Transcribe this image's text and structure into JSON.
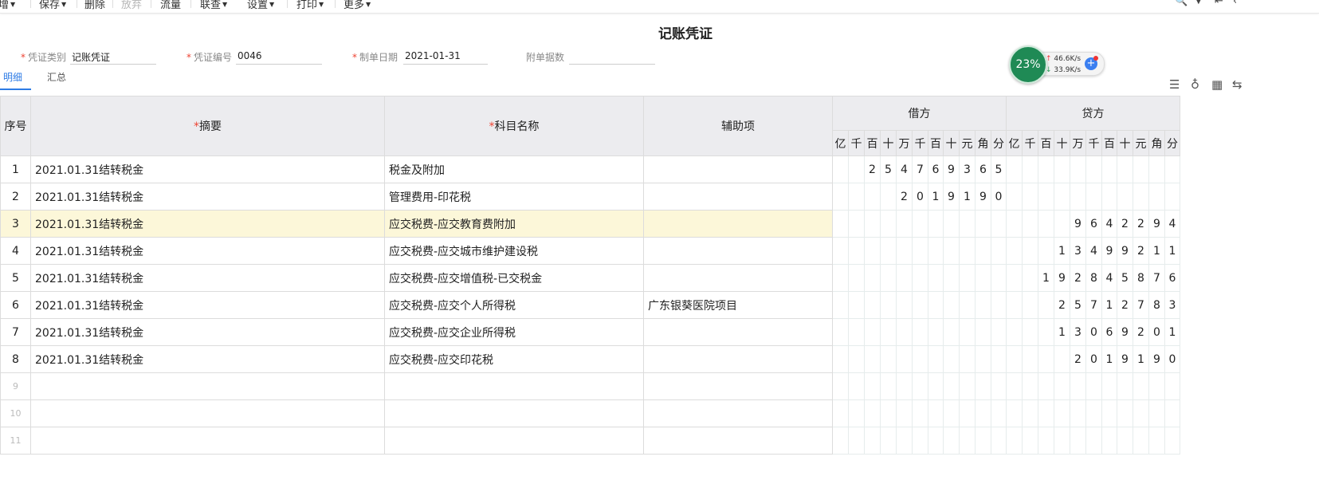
{
  "toolbar": {
    "items": [
      {
        "label": "增",
        "caret": true
      },
      {
        "label": "保存",
        "caret": true
      },
      {
        "label": "删除",
        "caret": false
      },
      {
        "label": "放弃",
        "caret": false
      },
      {
        "label": "流量",
        "caret": false
      },
      {
        "label": "联查",
        "caret": true
      },
      {
        "label": "设置",
        "caret": true
      },
      {
        "label": "打印",
        "caret": true
      },
      {
        "label": "更多",
        "caret": true
      }
    ],
    "right_icons": [
      "preview-icon",
      "chevron-down-icon",
      "first-icon",
      "prev-icon"
    ]
  },
  "title": "记账凭证",
  "fields": {
    "type": {
      "label": "凭证类别",
      "value": "记账凭证",
      "required": true
    },
    "number": {
      "label": "凭证编号",
      "value": "0046",
      "required": true
    },
    "date": {
      "label": "制单日期",
      "value": "2021-01-31",
      "required": true
    },
    "attachments": {
      "label": "附单据数",
      "value": "",
      "required": false
    }
  },
  "tabs": [
    {
      "label": "明细",
      "active": true
    },
    {
      "label": "汇总",
      "active": false
    }
  ],
  "network_widget": {
    "percent": "23%",
    "up": "46.6K/s",
    "down": "33.9K/s"
  },
  "table": {
    "headers": {
      "seq": "序号",
      "summary": "摘要",
      "account": "科目名称",
      "aux": "辅助项",
      "debit": "借方",
      "credit": "贷方",
      "digit_units": [
        "亿",
        "千",
        "百",
        "十",
        "万",
        "千",
        "百",
        "十",
        "元",
        "角",
        "分"
      ]
    },
    "rows": [
      {
        "seq": "1",
        "summary": "2021.01.31结转税金",
        "account": "税金及附加",
        "aux": "",
        "debit": "2547693 65",
        "credit": ""
      },
      {
        "seq": "2",
        "summary": "2021.01.31结转税金",
        "account": "管理费用-印花税",
        "aux": "",
        "debit": "201919 0",
        "credit": ""
      },
      {
        "seq": "3",
        "summary": "2021.01.31结转税金",
        "account": "应交税费-应交教育费附加",
        "aux": "",
        "debit": "",
        "credit": "9642294"
      },
      {
        "seq": "4",
        "summary": "2021.01.31结转税金",
        "account": "应交税费-应交城市维护建设税",
        "aux": "",
        "debit": "",
        "credit": "13499211"
      },
      {
        "seq": "5",
        "summary": "2021.01.31结转税金",
        "account": "应交税费-应交增值税-已交税金",
        "aux": "",
        "debit": "",
        "credit": "192845876"
      },
      {
        "seq": "6",
        "summary": "2021.01.31结转税金",
        "account": "应交税费-应交个人所得税",
        "aux": "广东银葵医院项目",
        "debit": "",
        "credit": "25712783"
      },
      {
        "seq": "7",
        "summary": "2021.01.31结转税金",
        "account": "应交税费-应交企业所得税",
        "aux": "",
        "debit": "",
        "credit": "13069201"
      },
      {
        "seq": "8",
        "summary": "2021.01.31结转税金",
        "account": "应交税费-应交印花税",
        "aux": "",
        "debit": "",
        "credit": "2019190"
      },
      {
        "seq": "9",
        "summary": "",
        "account": "",
        "aux": "",
        "debit": "",
        "credit": ""
      },
      {
        "seq": "10",
        "summary": "",
        "account": "",
        "aux": "",
        "debit": "",
        "credit": ""
      },
      {
        "seq": "11",
        "summary": "",
        "account": "",
        "aux": "",
        "debit": "",
        "credit": ""
      }
    ],
    "highlight_row": 3
  }
}
